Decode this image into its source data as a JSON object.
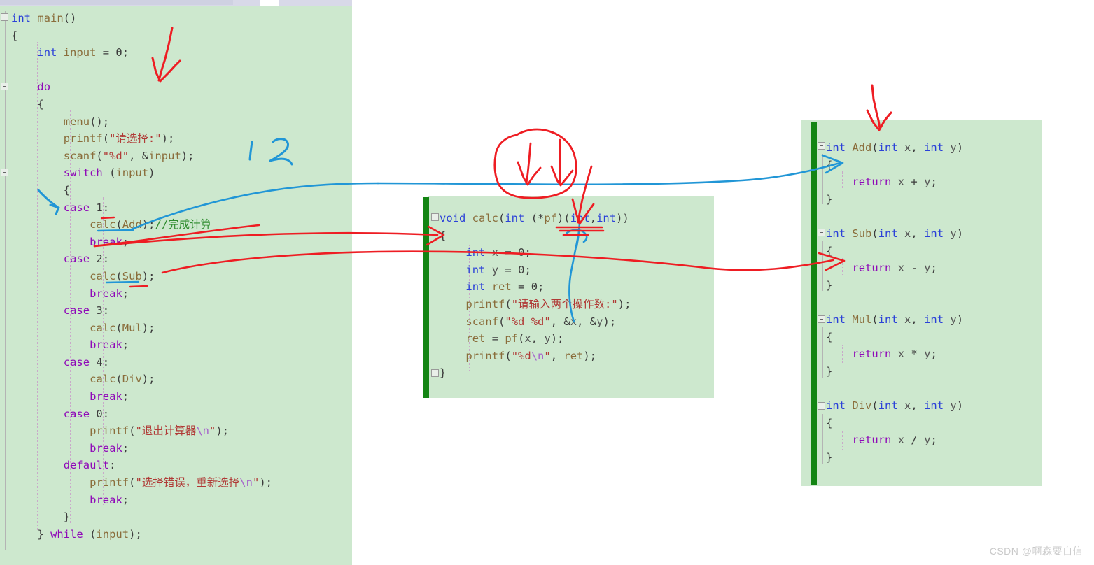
{
  "editor": {
    "background_color": "#cde8ce",
    "changebar_color": "#138513",
    "scrollbar_color": "#d8d9e8"
  },
  "panels": {
    "main": {
      "name": "main-function-panel",
      "lines": [
        "int main()",
        "{",
        "    int input = 0;",
        "",
        "    do",
        "    {",
        "        menu();",
        "        printf(\"请选择:\");",
        "        scanf(\"%d\", &input);",
        "        switch (input)",
        "        {",
        "        case 1:",
        "            calc(Add);//完成计算",
        "            break;",
        "        case 2:",
        "            calc(Sub);",
        "            break;",
        "        case 3:",
        "            calc(Mul);",
        "            break;",
        "        case 4:",
        "            calc(Div);",
        "            break;",
        "        case 0:",
        "            printf(\"退出计算器\\n\");",
        "            break;",
        "        default:",
        "            printf(\"选择错误，重新选择\\n\");",
        "            break;",
        "        }",
        "    } while (input);"
      ]
    },
    "calc": {
      "name": "calc-function-panel",
      "lines": [
        "void calc(int (*pf)(int,int))",
        "{",
        "    int x = 0;",
        "    int y = 0;",
        "    int ret = 0;",
        "    printf(\"请输入两个操作数:\");",
        "    scanf(\"%d %d\", &x, &y);",
        "    ret = pf(x, y);",
        "    printf(\"%d\\n\", ret);",
        "}"
      ]
    },
    "ops": {
      "name": "operations-panel",
      "lines": [
        "int Add(int x, int y)",
        "{",
        "    return x + y;",
        "}",
        "",
        "int Sub(int x, int y)",
        "{",
        "    return x - y;",
        "}",
        "",
        "int Mul(int x, int y)",
        "{",
        "    return x * y;",
        "}",
        "",
        "int Div(int x, int y)",
        "{",
        "    return x / y;",
        "}"
      ]
    }
  },
  "annotations": {
    "ink_red_color": "#ee1d23",
    "ink_blue_color": "#2196d6",
    "handwritten_digits": [
      "1",
      "2"
    ],
    "notes": [
      "red arrow down to int input = 0",
      "blue handwritten 1 2 next to scanf",
      "blue arrow to case 1",
      "blue curve from calc(Add) to Add function",
      "red curve from calc(Sub) to Sub function",
      "red circled scribble above calc function pointing to (*pf)",
      "red arrow down to Add function header"
    ]
  },
  "watermark": {
    "text": "CSDN @啊森要自信"
  }
}
